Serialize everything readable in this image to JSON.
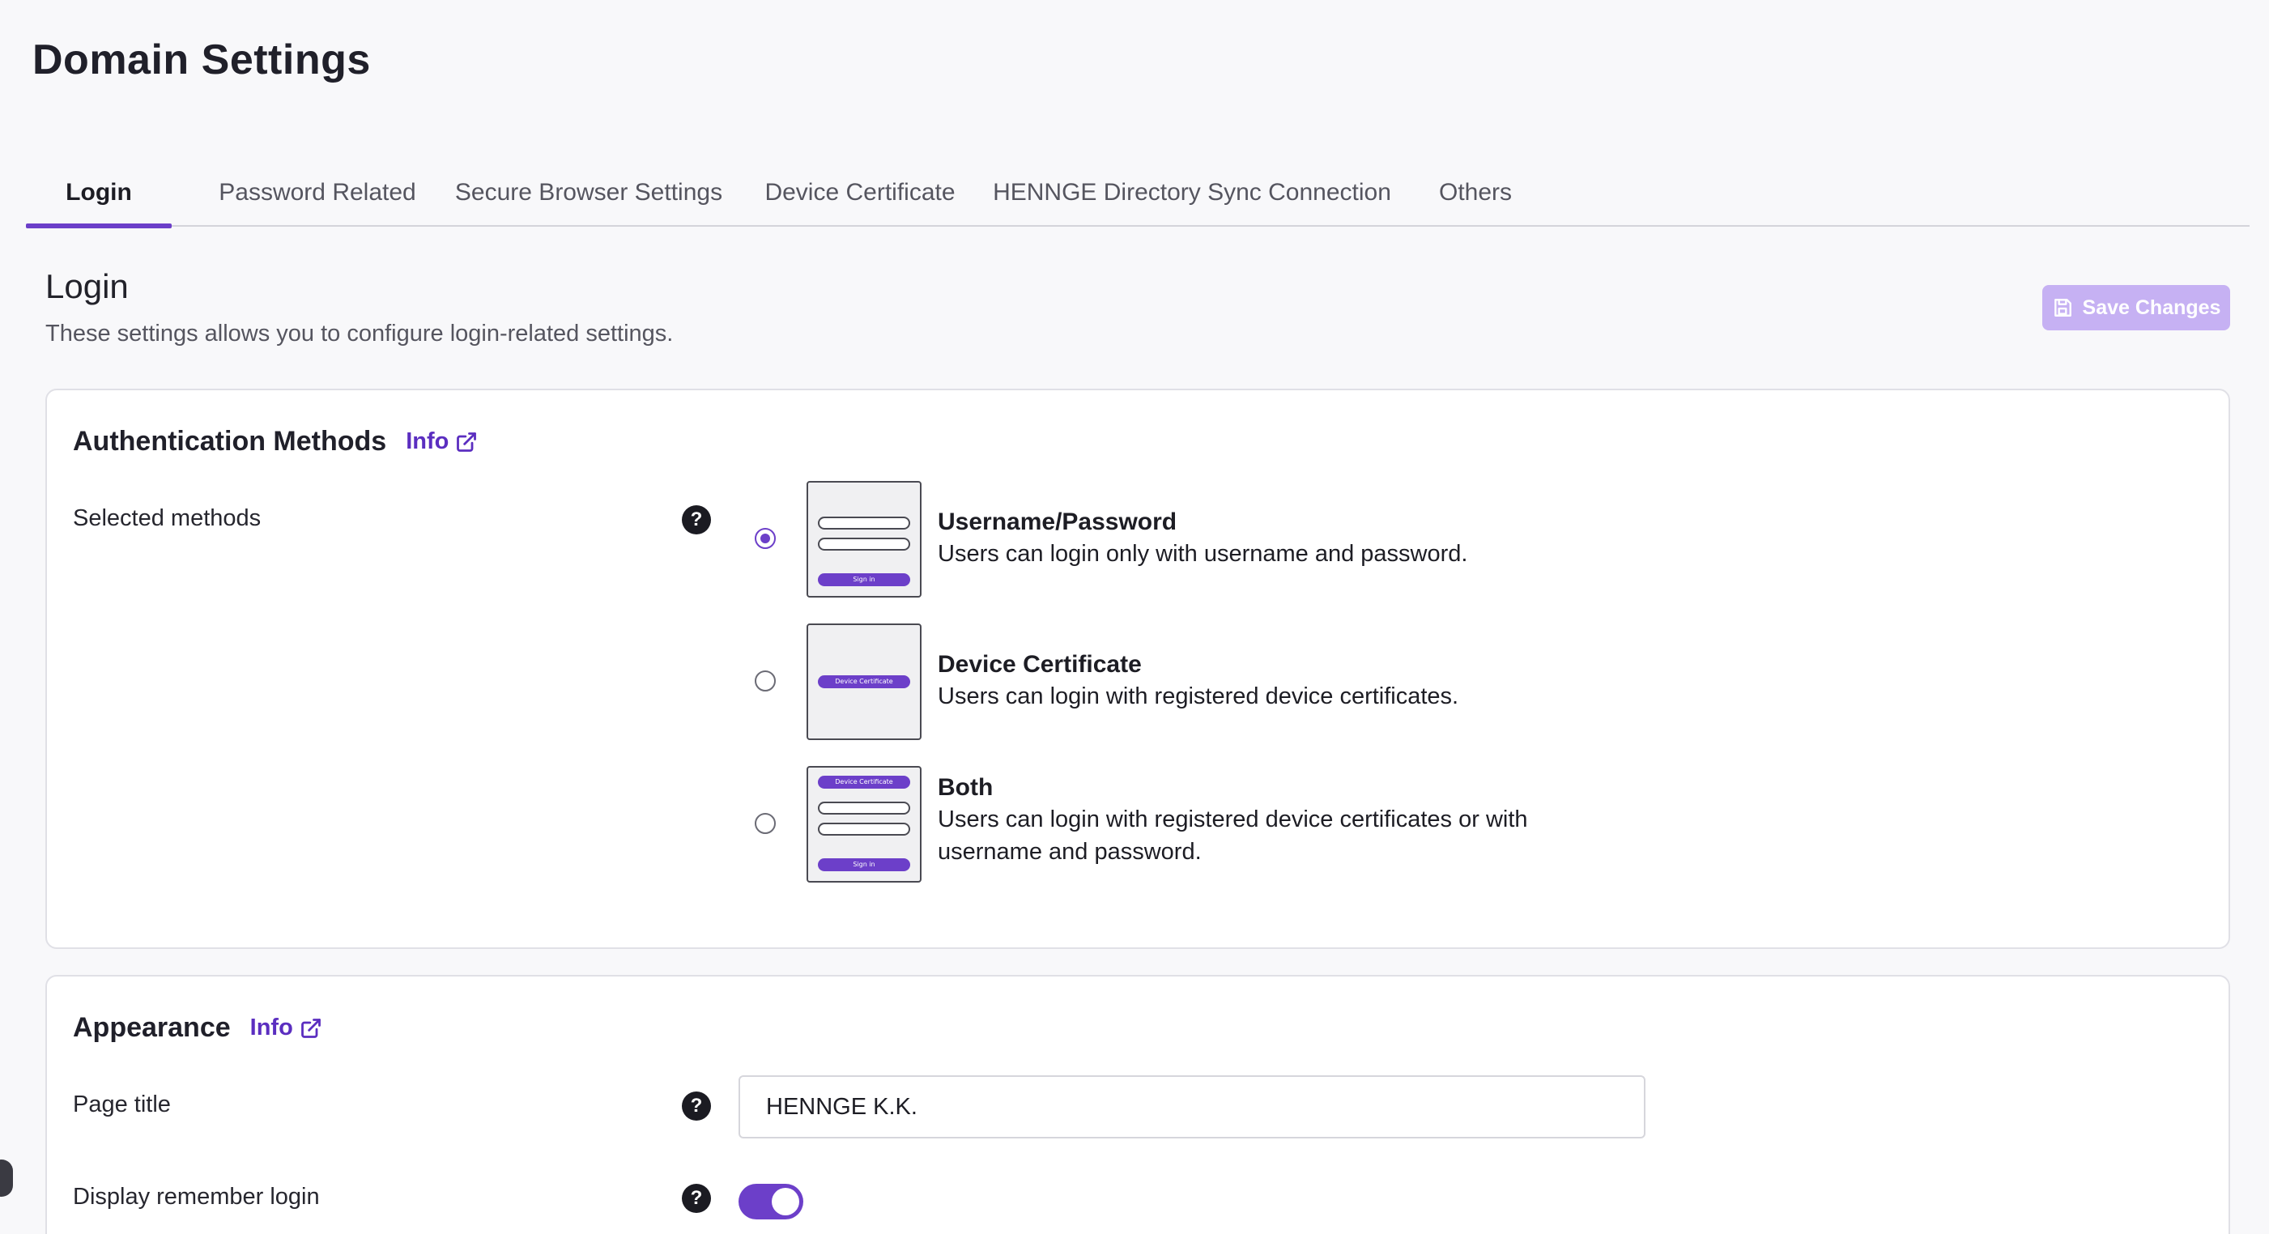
{
  "page": {
    "title": "Domain Settings"
  },
  "tabs": [
    {
      "label": "Login",
      "active": true
    },
    {
      "label": "Password Related",
      "active": false
    },
    {
      "label": "Secure Browser Settings",
      "active": false
    },
    {
      "label": "Device Certificate",
      "active": false
    },
    {
      "label": "HENNGE Directory Sync Connection",
      "active": false
    },
    {
      "label": "Others",
      "active": false
    }
  ],
  "section": {
    "title": "Login",
    "description": "These settings allows you to configure login-related settings.",
    "save_label": "Save Changes",
    "save_enabled": false
  },
  "auth": {
    "heading": "Authentication Methods",
    "info_label": "Info",
    "field_label": "Selected methods",
    "options": [
      {
        "title": "Username/Password",
        "description": "Users can login only with username and password.",
        "selected": true,
        "thumb_sign_in": "Sign in"
      },
      {
        "title": "Device Certificate",
        "description": "Users can login with registered device certificates.",
        "selected": false,
        "thumb_cert": "Device Certificate"
      },
      {
        "title": "Both",
        "description": "Users can login with registered device certificates or with username and password.",
        "selected": false,
        "thumb_cert": "Device Certificate",
        "thumb_sign_in": "Sign in"
      }
    ]
  },
  "appearance": {
    "heading": "Appearance",
    "info_label": "Info",
    "page_title_label": "Page title",
    "page_title_value": "HENNGE K.K.",
    "remember_label": "Display remember login",
    "remember_enabled": true
  },
  "colors": {
    "accent": "#6c3fc9",
    "save_disabled": "#c6b1f3"
  },
  "icons": {
    "help": "question-circle-icon",
    "external": "external-link-icon",
    "save": "floppy-disk-icon"
  }
}
